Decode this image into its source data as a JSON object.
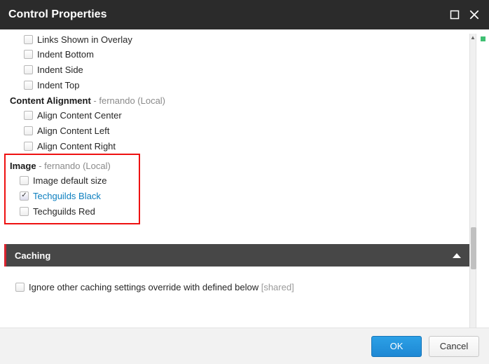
{
  "dialog": {
    "title": "Control Properties"
  },
  "styling": {
    "truncated_item": "Links Shown in Overlay",
    "items": [
      {
        "label": "Indent Bottom",
        "checked": false
      },
      {
        "label": "Indent Side",
        "checked": false
      },
      {
        "label": "Indent Top",
        "checked": false
      }
    ]
  },
  "content_alignment": {
    "heading": "Content Alignment",
    "scope": "- fernando (Local)",
    "items": [
      {
        "label": "Align Content Center",
        "checked": false
      },
      {
        "label": "Align Content Left",
        "checked": false
      },
      {
        "label": "Align Content Right",
        "checked": false
      }
    ]
  },
  "image": {
    "heading": "Image",
    "scope": "- fernando (Local)",
    "items": [
      {
        "label": "Image default size",
        "checked": false,
        "link": false
      },
      {
        "label": "Techguilds Black",
        "checked": true,
        "link": true
      },
      {
        "label": "Techguilds Red",
        "checked": false,
        "link": false
      }
    ]
  },
  "caching": {
    "heading": "Caching",
    "option_label": "Ignore other caching settings override with defined below",
    "option_suffix": "[shared]",
    "checked": false
  },
  "buttons": {
    "ok": "OK",
    "cancel": "Cancel"
  }
}
